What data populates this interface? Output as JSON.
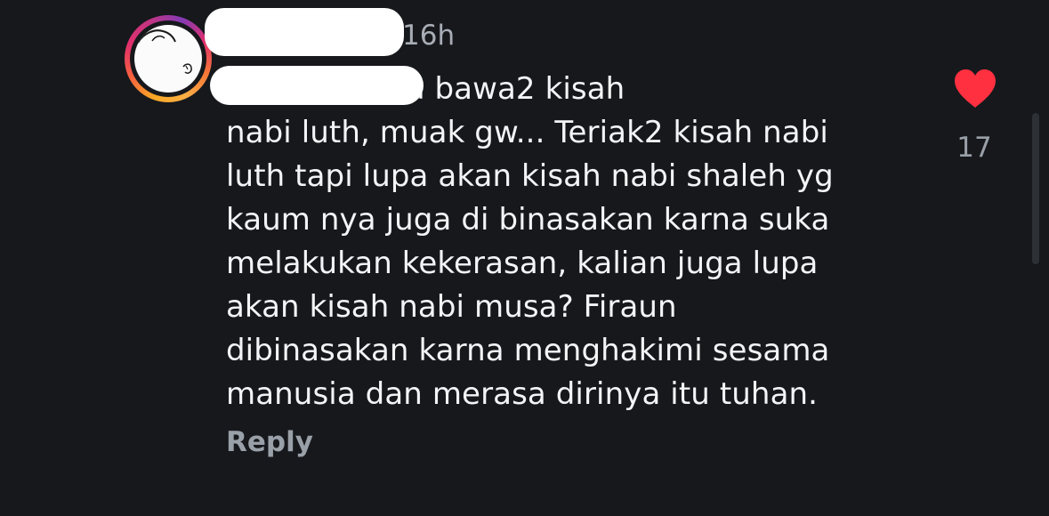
{
  "comment": {
    "timestamp": "16h",
    "mention_fragment": "ry",
    "lines": [
      " tidak usah bawa2 kisah",
      "nabi luth, muak gw... Teriak2 kisah nabi",
      "luth tapi lupa akan kisah nabi shaleh yg",
      "kaum nya juga di binasakan karna suka",
      "melakukan kekerasan, kalian juga lupa",
      "akan kisah nabi musa? Firaun",
      "dibinasakan karna menghakimi sesama",
      "manusia dan merasa dirinya itu tuhan."
    ],
    "reply_label": "Reply",
    "like_count": "17",
    "colors": {
      "background": "#16181c",
      "mention": "#7f97ff",
      "heart": "#ff3040",
      "muted_text": "#9aa0a8"
    },
    "icons": {
      "like": "heart-icon"
    }
  }
}
